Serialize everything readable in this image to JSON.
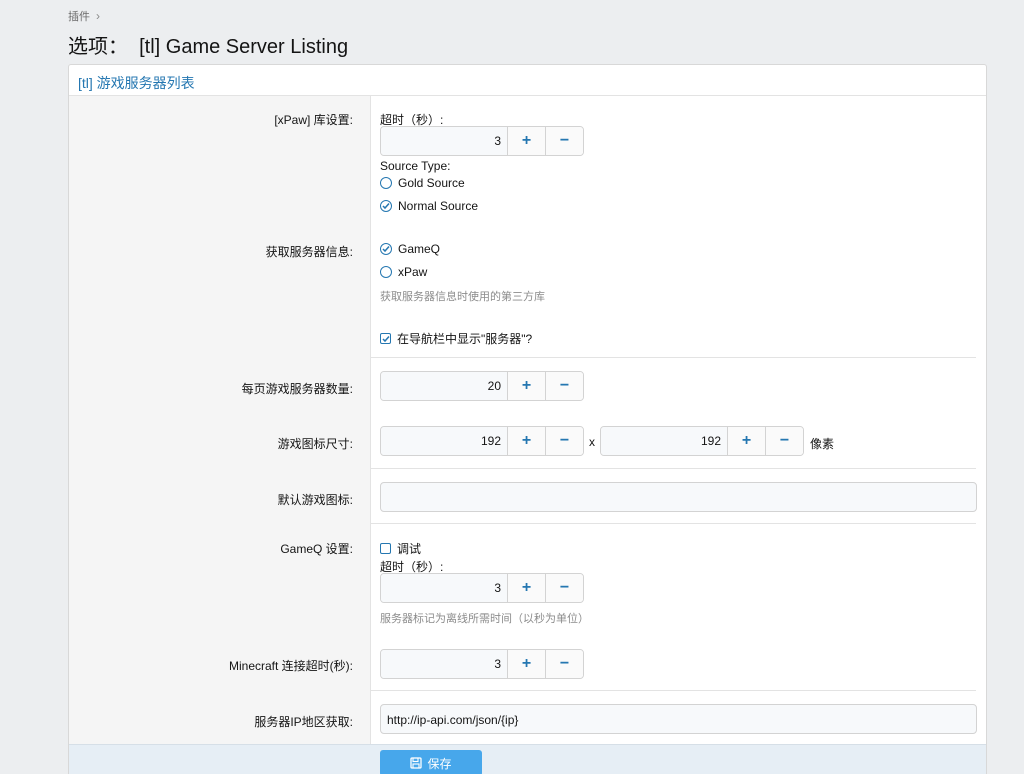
{
  "breadcrumb": {
    "item": "插件"
  },
  "page": {
    "title": "选项：  [tl] Game Server Listing"
  },
  "panel": {
    "header": "[tl] 游戏服务器列表"
  },
  "xpaw": {
    "label": "[xPaw] 库设置:",
    "timeout_label": "超时（秒）:",
    "timeout_value": "3",
    "source_type_label": "Source Type:",
    "source_options": [
      {
        "label": "Gold Source",
        "selected": false
      },
      {
        "label": "Normal Source",
        "selected": true
      }
    ]
  },
  "fetch_info": {
    "label": "获取服务器信息:",
    "options": [
      {
        "label": "GameQ",
        "selected": true
      },
      {
        "label": "xPaw",
        "selected": false
      }
    ],
    "hint": "获取服务器信息时使用的第三方库",
    "nav_checkbox": {
      "label": "在导航栏中显示\"服务器\"?",
      "checked": true
    }
  },
  "per_page": {
    "label": "每页游戏服务器数量:",
    "value": "20"
  },
  "icon_size": {
    "label": "游戏图标尺寸:",
    "width": "192",
    "height": "192",
    "separator": "x",
    "unit": "像素"
  },
  "default_icon": {
    "label": "默认游戏图标:",
    "value": ""
  },
  "gameq": {
    "label": "GameQ 设置:",
    "debug_label": "调试",
    "debug_checked": false,
    "timeout_label": "超时（秒）:",
    "timeout_value": "3",
    "hint": "服务器标记为离线所需时间（以秒为单位）"
  },
  "minecraft": {
    "label": "Minecraft 连接超时(秒):",
    "value": "3"
  },
  "ip_region": {
    "label": "服务器IP地区获取:",
    "value": "http://ip-api.com/json/{ip}"
  },
  "footer": {
    "save_label": "保存"
  },
  "colors": {
    "accent": "#2577b1",
    "button": "#47a7eb",
    "sidebar": "#f5f5f5"
  }
}
